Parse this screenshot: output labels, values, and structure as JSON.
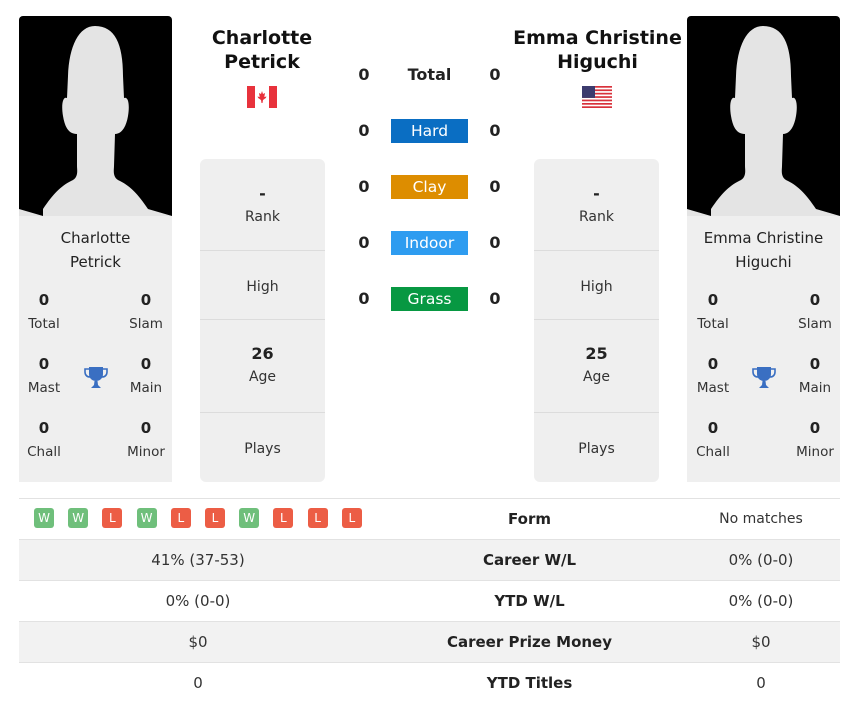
{
  "colors": {
    "hard": "#0a6ec3",
    "clay": "#dd8d00",
    "indoor": "#2e9cf0",
    "grass": "#079842",
    "win": "#6fbf7b",
    "loss": "#ec5d45",
    "trophy": "#3a6fc2"
  },
  "player1": {
    "name_line1": "Charlotte",
    "name_line2": "Petrick",
    "card_name_line1": "Charlotte",
    "card_name_line2": "Petrick",
    "flag": "canada-flag",
    "titles": {
      "total": {
        "value": "0",
        "label": "Total"
      },
      "slam": {
        "value": "0",
        "label": "Slam"
      },
      "mast": {
        "value": "0",
        "label": "Mast"
      },
      "main": {
        "value": "0",
        "label": "Main"
      },
      "chall": {
        "value": "0",
        "label": "Chall"
      },
      "minor": {
        "value": "0",
        "label": "Minor"
      }
    },
    "rank": {
      "value": "-",
      "label": "Rank"
    },
    "high": {
      "value": "",
      "label": "High"
    },
    "age": {
      "value": "26",
      "label": "Age"
    },
    "plays": {
      "value": "",
      "label": "Plays"
    }
  },
  "player2": {
    "name_line1": "Emma Christine",
    "name_line2": "Higuchi",
    "card_name_line1": "Emma Christine",
    "card_name_line2": "Higuchi",
    "flag": "usa-flag",
    "titles": {
      "total": {
        "value": "0",
        "label": "Total"
      },
      "slam": {
        "value": "0",
        "label": "Slam"
      },
      "mast": {
        "value": "0",
        "label": "Mast"
      },
      "main": {
        "value": "0",
        "label": "Main"
      },
      "chall": {
        "value": "0",
        "label": "Chall"
      },
      "minor": {
        "value": "0",
        "label": "Minor"
      }
    },
    "rank": {
      "value": "-",
      "label": "Rank"
    },
    "high": {
      "value": "",
      "label": "High"
    },
    "age": {
      "value": "25",
      "label": "Age"
    },
    "plays": {
      "value": "",
      "label": "Plays"
    }
  },
  "h2h": [
    {
      "label": "Total",
      "p1": "0",
      "p2": "0",
      "key": "total"
    },
    {
      "label": "Hard",
      "p1": "0",
      "p2": "0",
      "key": "hard"
    },
    {
      "label": "Clay",
      "p1": "0",
      "p2": "0",
      "key": "clay"
    },
    {
      "label": "Indoor",
      "p1": "0",
      "p2": "0",
      "key": "indoor"
    },
    {
      "label": "Grass",
      "p1": "0",
      "p2": "0",
      "key": "grass"
    }
  ],
  "comparison": {
    "form": {
      "label": "Form",
      "p1": [
        "W",
        "W",
        "L",
        "W",
        "L",
        "L",
        "W",
        "L",
        "L",
        "L"
      ],
      "p2": "No matches"
    },
    "rows": [
      {
        "label": "Career W/L",
        "p1": "41% (37-53)",
        "p2": "0% (0-0)"
      },
      {
        "label": "YTD W/L",
        "p1": "0% (0-0)",
        "p2": "0% (0-0)"
      },
      {
        "label": "Career Prize Money",
        "p1": "$0",
        "p2": "$0"
      },
      {
        "label": "YTD Titles",
        "p1": "0",
        "p2": "0"
      }
    ]
  }
}
